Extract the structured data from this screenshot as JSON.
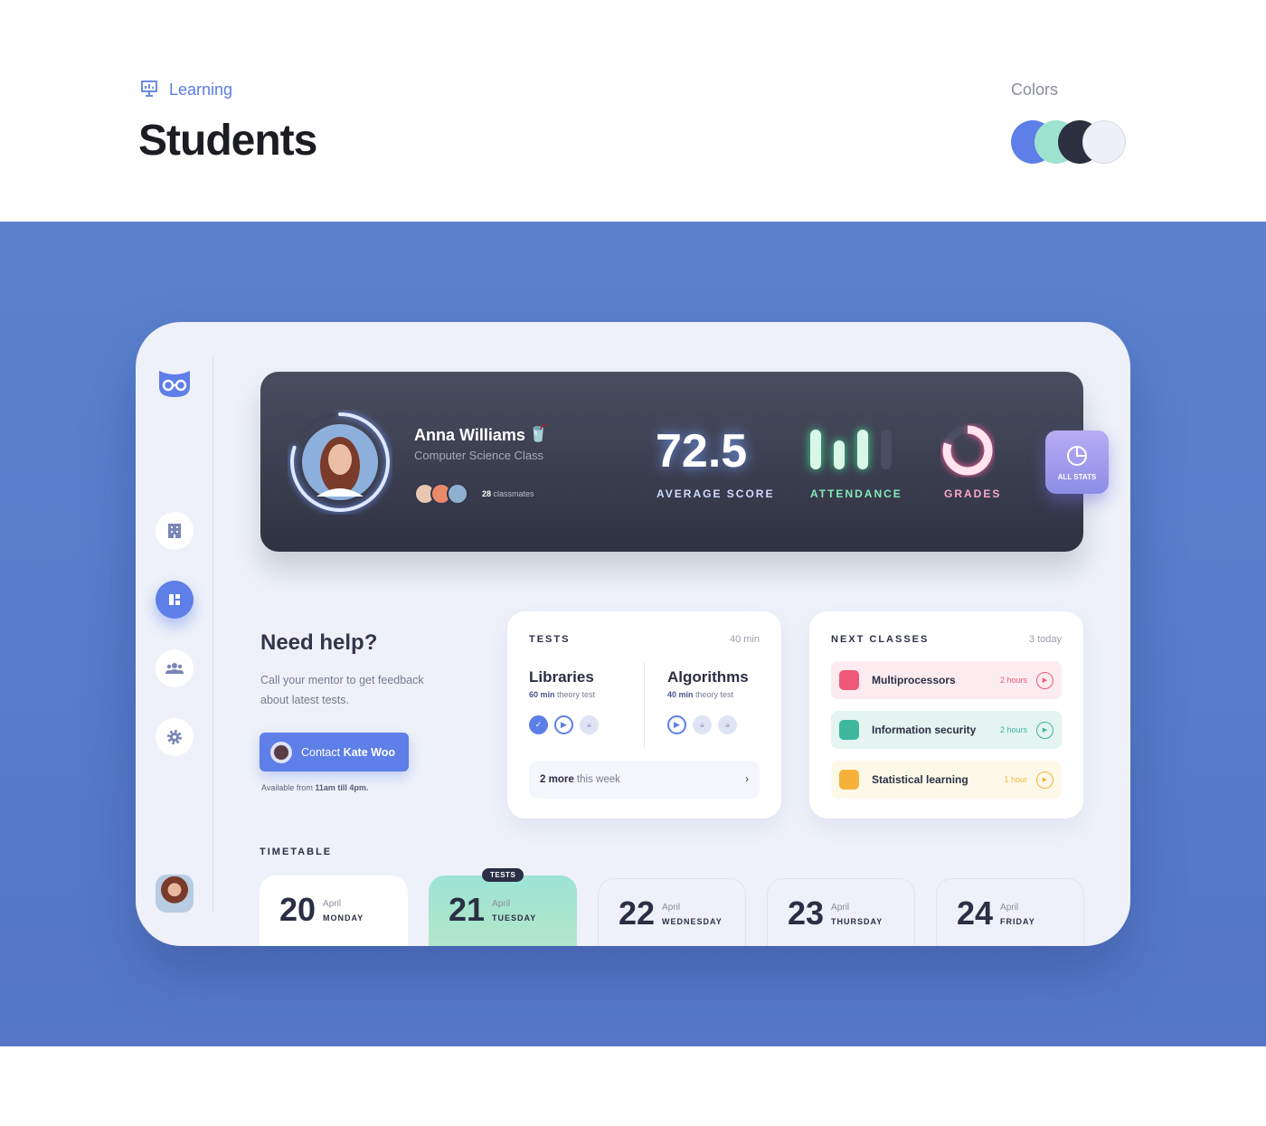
{
  "header": {
    "section": "Learning",
    "title": "Students",
    "colors_label": "Colors",
    "colors": [
      "#5e7ee8",
      "#9ee3cf",
      "#2b2f3f",
      "#eef0f8"
    ]
  },
  "sidebar": {
    "items": [
      {
        "name": "building-icon"
      },
      {
        "name": "dashboard-icon",
        "active": true
      },
      {
        "name": "users-icon"
      },
      {
        "name": "gear-icon"
      }
    ]
  },
  "profile": {
    "name": "Anna Williams",
    "class": "Computer Science Class",
    "classmates_count": "28",
    "classmates_label": "classmates",
    "progress": 0.8
  },
  "stats": {
    "average_score": "72.5",
    "average_label": "AVERAGE SCORE",
    "attendance_label": "ATTENDANCE",
    "attendance_bars": [
      1,
      1,
      1,
      0
    ],
    "grades_label": "GRADES",
    "grades_fraction": 0.8,
    "all_stats": "ALL STATS"
  },
  "help": {
    "title": "Need help?",
    "text": "Call your mentor to get feedback about latest tests.",
    "button_prefix": "Contact ",
    "button_name": "Kate Woo",
    "avail_prefix": "Available from ",
    "avail_time": "11am till 4pm."
  },
  "tests": {
    "title": "TESTS",
    "meta": "40 min",
    "items": [
      {
        "name": "Libraries",
        "duration": "60 min",
        "type": "theory test",
        "steps": [
          "done",
          "play",
          "lock"
        ]
      },
      {
        "name": "Algorithms",
        "duration": "40 min",
        "type": "theory test",
        "steps": [
          "play",
          "lock",
          "lock"
        ]
      }
    ],
    "more_count": "2 more",
    "more_label": "this week"
  },
  "next_classes": {
    "title": "NEXT CLASSES",
    "meta": "3 today",
    "items": [
      {
        "name": "Multiprocessors",
        "time": "2 hours",
        "color": "#f0587a",
        "bg": "#fdecef"
      },
      {
        "name": "Information security",
        "time": "2 hours",
        "color": "#3fb79c",
        "bg": "#e3f4f1"
      },
      {
        "name": "Statistical learning",
        "time": "1 hour",
        "color": "#f7b23b",
        "bg": "#fdf9e8"
      }
    ]
  },
  "timetable": {
    "title": "TIMETABLE",
    "badge": "TESTS",
    "days": [
      {
        "num": "20",
        "month": "April",
        "weekday": "MONDAY"
      },
      {
        "num": "21",
        "month": "April",
        "weekday": "TUESDAY"
      },
      {
        "num": "22",
        "month": "April",
        "weekday": "WEDNESDAY"
      },
      {
        "num": "23",
        "month": "April",
        "weekday": "THURSDAY"
      },
      {
        "num": "24",
        "month": "April",
        "weekday": "FRIDAY"
      }
    ]
  }
}
